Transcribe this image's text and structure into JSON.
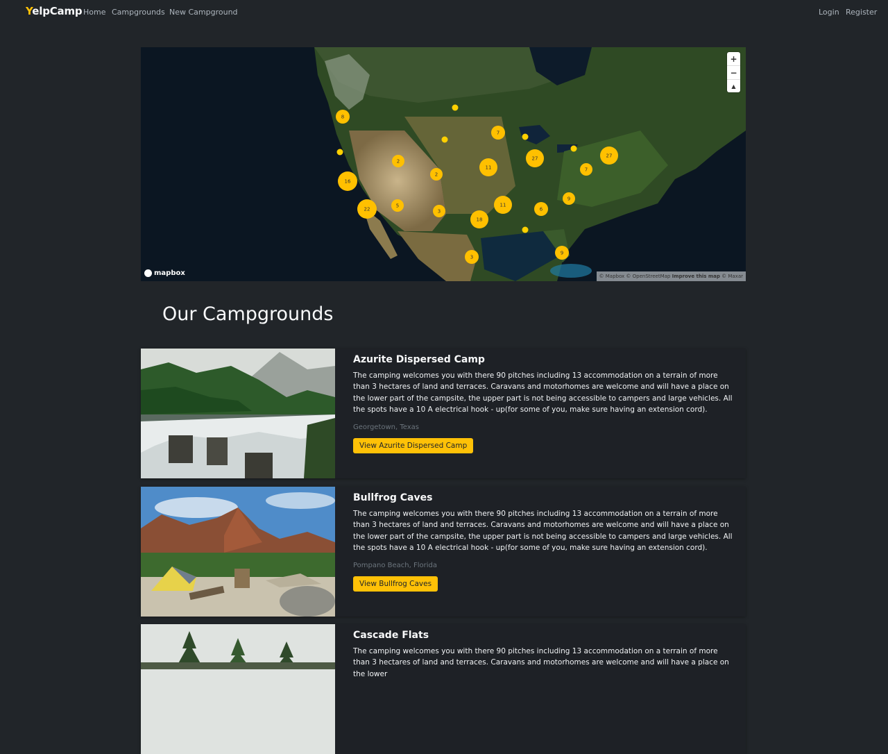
{
  "navbar": {
    "brand_initial": "Y",
    "brand_rest": "elpCamp",
    "links": [
      "Home",
      "Campgrounds",
      "New Campground"
    ],
    "login": "Login",
    "register": "Register"
  },
  "map": {
    "logo_text": "mapbox",
    "zoom_in": "+",
    "zoom_out": "−",
    "compass": "▲",
    "attribution_prefix": "© Mapbox © OpenStreetMap",
    "attribution_improve": "Improve this map",
    "attribution_suffix": "© Maxar",
    "clusters": [
      "8",
      "7",
      "2",
      "2",
      "11",
      "27",
      "7",
      "27",
      "16",
      "5",
      "22",
      "3",
      "11",
      "6",
      "9",
      "18",
      "3",
      "9"
    ]
  },
  "page": {
    "title": "Our Campgrounds"
  },
  "campgrounds": [
    {
      "title": "Azurite Dispersed Camp",
      "description": "The camping welcomes you with there 90 pitches including 13 accommodation on a terrain of more than 3 hectares of land and terraces. Caravans and motorhomes are welcome and will have a place on the lower part of the campsite, the upper part is not being accessible to campers and large vehicles. All the spots have a 10 A electrical hook - up(for some of you, make sure having an extension cord).",
      "location": "Georgetown, Texas",
      "button": "View Azurite Dispersed Camp"
    },
    {
      "title": "Bullfrog Caves",
      "description": "The camping welcomes you with there 90 pitches including 13 accommodation on a terrain of more than 3 hectares of land and terraces. Caravans and motorhomes are welcome and will have a place on the lower part of the campsite, the upper part is not being accessible to campers and large vehicles. All the spots have a 10 A electrical hook - up(for some of you, make sure having an extension cord).",
      "location": "Pompano Beach, Florida",
      "button": "View Bullfrog Caves"
    },
    {
      "title": "Cascade Flats",
      "description": "The camping welcomes you with there 90 pitches including 13 accommodation on a terrain of more than 3 hectares of land and terraces. Caravans and motorhomes are welcome and will have a place on the lower"
    }
  ],
  "colors": {
    "accent": "#ffc107",
    "background": "#212529",
    "card": "#1e2126"
  }
}
